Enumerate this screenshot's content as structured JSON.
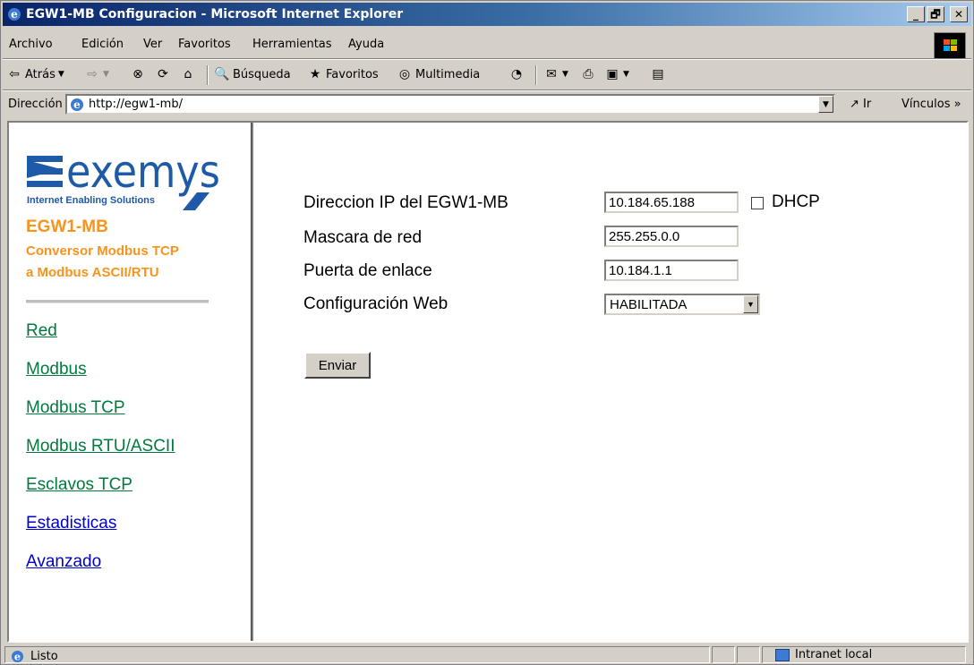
{
  "window": {
    "title": "EGW1-MB Configuracion - Microsoft Internet Explorer"
  },
  "menubar": {
    "items": [
      "Archivo",
      "Edición",
      "Ver",
      "Favoritos",
      "Herramientas",
      "Ayuda"
    ]
  },
  "toolbar": {
    "back": "Atrás",
    "search": "Búsqueda",
    "favorites": "Favoritos",
    "media": "Multimedia"
  },
  "address": {
    "label": "Dirección",
    "url": "http://egw1-mb/",
    "go": "Ir",
    "links": "Vínculos »"
  },
  "sidebar": {
    "logo_text": "exemys",
    "logo_tagline": "Internet Enabling Solutions",
    "product": "EGW1-MB",
    "description_line1": "Conversor Modbus TCP",
    "description_line2": "a Modbus ASCII/RTU",
    "nav": [
      "Red",
      "Modbus",
      "Modbus TCP",
      "Modbus RTU/ASCII",
      "Esclavos TCP",
      "Estadisticas",
      "Avanzado"
    ]
  },
  "form": {
    "ip_label": "Direccion IP del EGW1-MB",
    "ip_value": "10.184.65.188",
    "dhcp_label": "DHCP",
    "dhcp_checked": false,
    "mask_label": "Mascara de red",
    "mask_value": "255.255.0.0",
    "gateway_label": "Puerta de enlace",
    "gateway_value": "10.184.1.1",
    "web_label": "Configuración Web",
    "web_value": "HABILITADA",
    "submit": "Enviar"
  },
  "status": {
    "text": "Listo",
    "zone": "Intranet local"
  },
  "colors": {
    "orange": "#f7941d",
    "visited_link": "#007a3d",
    "link": "#0000cc",
    "logo_blue": "#1e5aa8"
  }
}
